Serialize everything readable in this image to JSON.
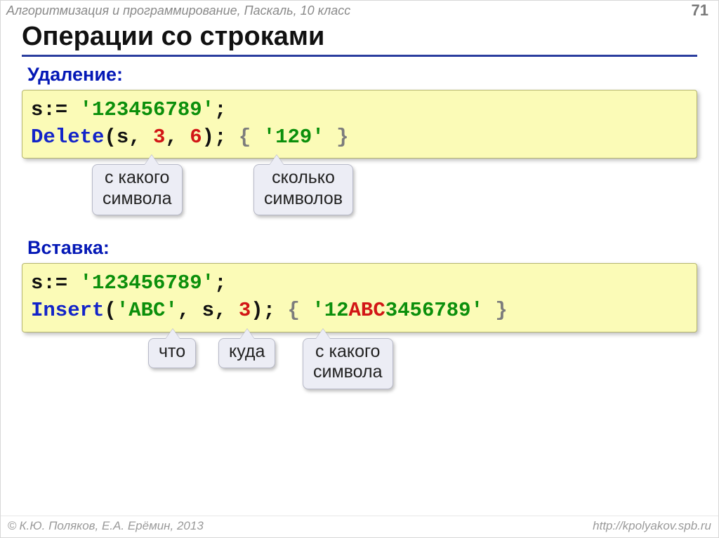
{
  "header": {
    "course": "Алгоритмизация и программирование, Паскаль, 10 класс",
    "page": "71"
  },
  "title": "Операции со строками",
  "sections": {
    "delete": {
      "label": "Удаление:",
      "code": {
        "l1_assign": "s:=",
        "l1_str": "'123456789'",
        "l1_semi": ";",
        "l2_fn": "Delete",
        "l2_open": "(s,",
        "l2_arg1": "3",
        "l2_comma": ",",
        "l2_arg2": "6",
        "l2_close": ");",
        "l2_cmt_open": "{",
        "l2_cmt_val": "'129'",
        "l2_cmt_close": "}"
      },
      "callouts": {
        "from": "с какого\nсимвола",
        "count": "сколько\nсимволов"
      }
    },
    "insert": {
      "label": "Вставка:",
      "code": {
        "l1_assign": "s:=",
        "l1_str": "'123456789'",
        "l1_semi": ";",
        "l2_fn": "Insert",
        "l2_open": "(",
        "l2_what": "'ABC'",
        "l2_c1": ",",
        "l2_where": "s",
        "l2_c2": ",",
        "l2_from": "3",
        "l2_close": ");",
        "l2_cmt_open": "{",
        "l2_cmt_pre": "'12",
        "l2_cmt_ins": "ABC",
        "l2_cmt_post": "3456789'",
        "l2_cmt_close": "}"
      },
      "callouts": {
        "what": "что",
        "where": "куда",
        "from": "с какого\nсимвола"
      }
    }
  },
  "footer": {
    "copyright": "К.Ю. Поляков, Е.А. Ерёмин, 2013",
    "url": "http://kpolyakov.spb.ru"
  }
}
